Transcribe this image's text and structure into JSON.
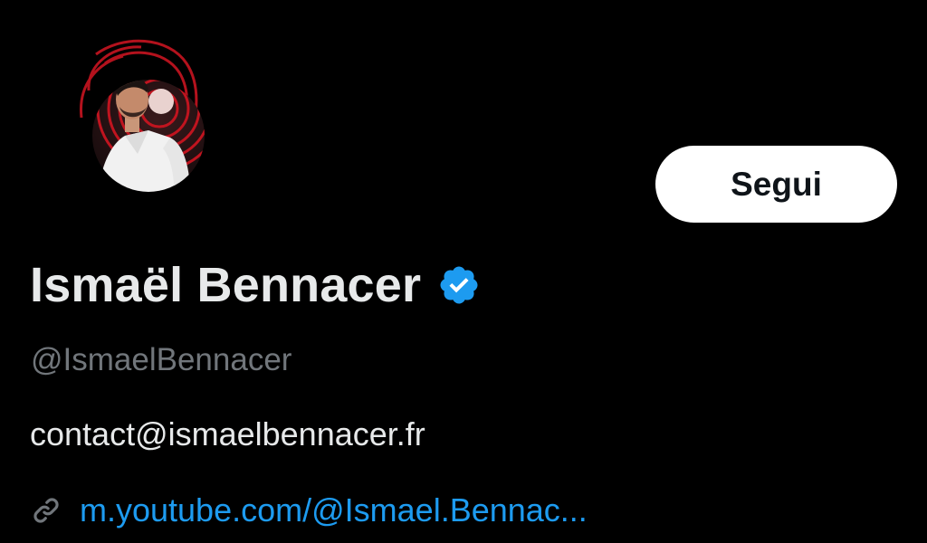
{
  "profile": {
    "display_name": "Ismaël Bennacer",
    "handle": "@IsmaelBennacer",
    "bio": "contact@ismaelbennacer.fr",
    "link_text": "m.youtube.com/@Ismael.Bennac...",
    "verified": true,
    "avatar_icon": "profile-photo"
  },
  "actions": {
    "follow_label": "Segui"
  },
  "icons": {
    "verified": "verified-badge-icon",
    "link": "link-icon"
  },
  "colors": {
    "background": "#000000",
    "primary_text": "#e7e9ea",
    "secondary_text": "#71767b",
    "accent": "#1d9bf0",
    "button_bg": "#ffffff",
    "button_text": "#0f1419"
  }
}
